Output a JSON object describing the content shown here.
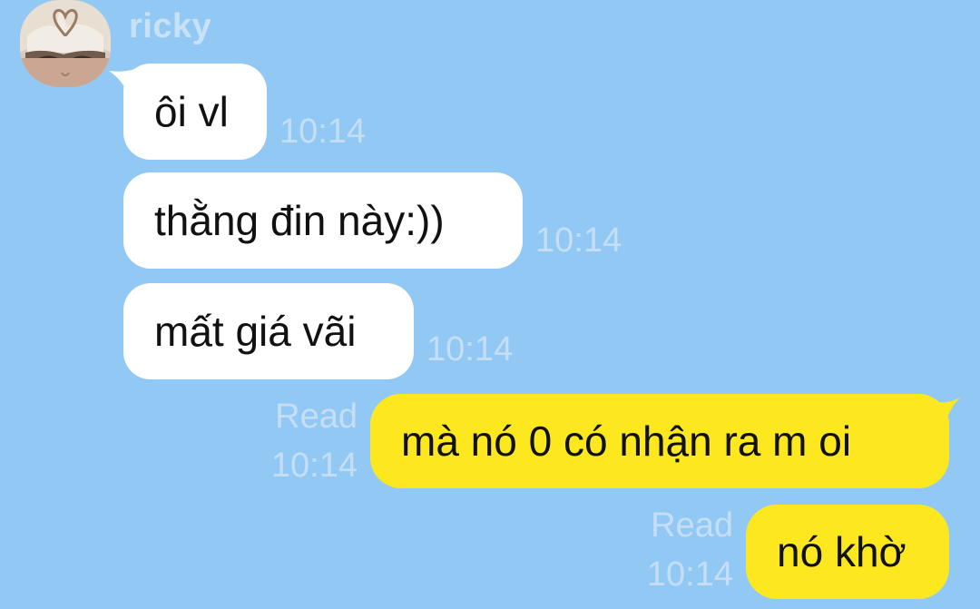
{
  "conversation": {
    "sender_name": "ricky",
    "colors": {
      "background": "#92c9f4",
      "incoming_bubble": "#ffffff",
      "outgoing_bubble": "#fde81f",
      "meta_text": "#c5def5"
    },
    "incoming": [
      {
        "text": "ôi vl",
        "time": "10:14"
      },
      {
        "text": "thằng đin này:))",
        "time": "10:14"
      },
      {
        "text": "mất giá vãi",
        "time": "10:14"
      }
    ],
    "outgoing": [
      {
        "text": "mà nó 0 có nhận ra m oi",
        "status": "Read",
        "time": "10:14"
      },
      {
        "text": "nó khờ",
        "status": "Read",
        "time": "10:14"
      }
    ]
  }
}
